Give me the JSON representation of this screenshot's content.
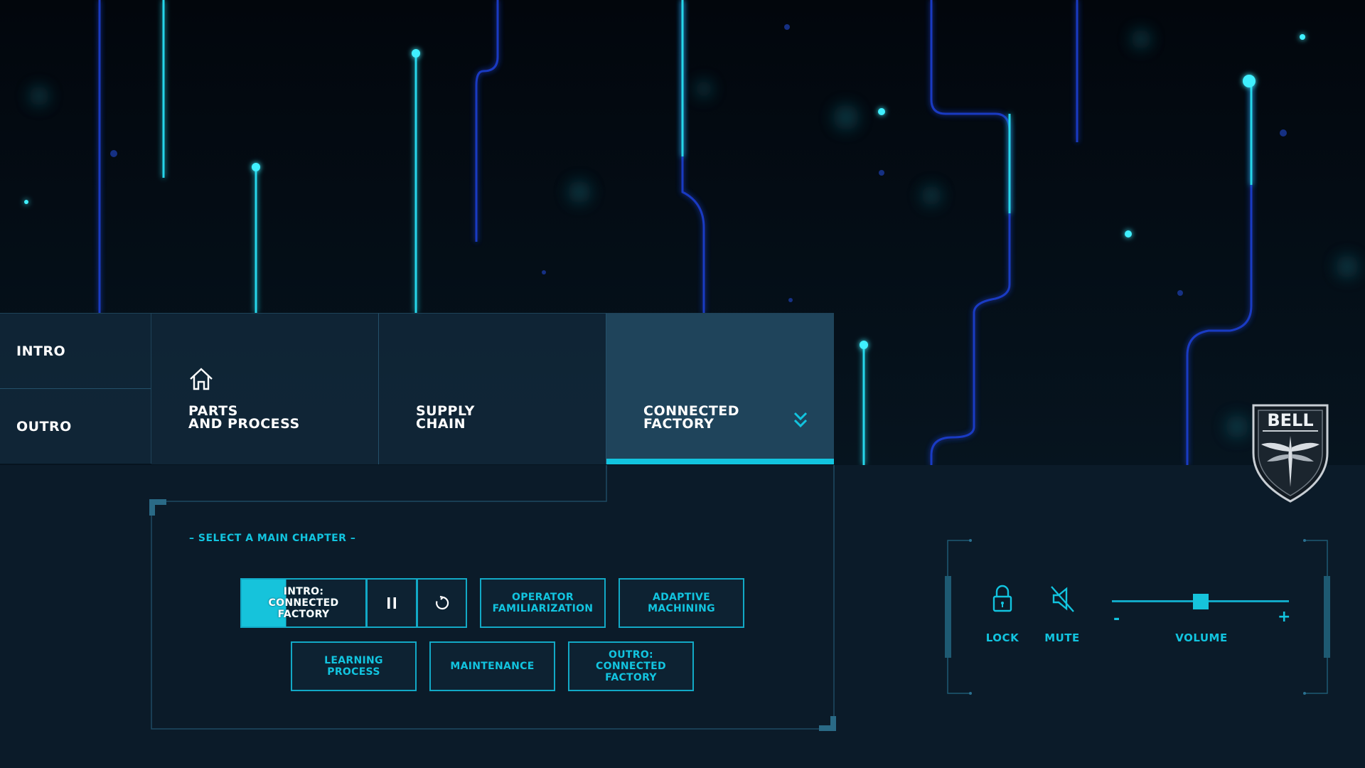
{
  "nav": {
    "intro_label": "INTRO",
    "outro_label": "OUTRO",
    "tabs": [
      {
        "label": "PARTS\nAND PROCESS",
        "icon": "home-icon"
      },
      {
        "label": "SUPPLY\nCHAIN"
      },
      {
        "label": "CONNECTED\nFACTORY",
        "icon": "chevron-double-down-icon",
        "active": true
      }
    ]
  },
  "chapters": {
    "prompt": "– SELECT A MAIN CHAPTER –",
    "current": {
      "label": "INTRO:\nCONNECTED\nFACTORY",
      "progress_percent": 36
    },
    "items": [
      "OPERATOR\nFAMILIARIZATION",
      "ADAPTIVE\nMACHINING",
      "LEARNING\nPROCESS",
      "MAINTENANCE",
      "OUTRO:\nCONNECTED\nFACTORY"
    ],
    "controls": {
      "pause_icon": "pause-icon",
      "replay_icon": "replay-icon"
    }
  },
  "controls": {
    "lock_label": "LOCK",
    "mute_label": "MUTE",
    "volume_label": "VOLUME",
    "volume_minus": "-",
    "volume_plus": "+",
    "volume_fraction": 0.5
  },
  "brand": {
    "logo_text": "BELL",
    "accent": "#12c4df",
    "panel": "#0b1b29"
  }
}
